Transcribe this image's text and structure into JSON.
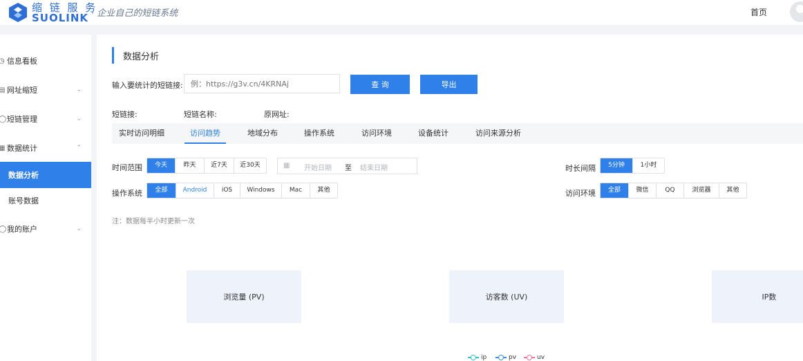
{
  "header": {
    "brand_cn": "缩 链 服 务",
    "brand_en": "SUOLINK",
    "slogan": "· 企业自己的短链系统",
    "home": "首页"
  },
  "sidebar": {
    "items": [
      {
        "label": "信息看板",
        "icon": "clock-icon"
      },
      {
        "label": "网址缩短",
        "icon": "page-icon"
      },
      {
        "label": "短链管理",
        "icon": "link-icon"
      },
      {
        "label": "数据统计",
        "icon": "stats-icon"
      },
      {
        "label": "数据分析"
      },
      {
        "label": "账号数据"
      },
      {
        "label": "我的账户",
        "icon": "user-icon"
      }
    ]
  },
  "main": {
    "title": "数据分析",
    "input_label": "输入要统计的短链接:",
    "input_placeholder": "例：https://g3v.cn/4KRNAj",
    "query_button": "查 询",
    "export_button": "导出",
    "info": {
      "short_link": "短链接:",
      "short_name": "短链名称:",
      "origin_url": "原网址:"
    },
    "tabs": [
      "实时访问明细",
      "访问趋势",
      "地域分布",
      "操作系统",
      "访问环境",
      "设备统计",
      "访问来源分析"
    ],
    "active_tab": "访问趋势",
    "time_range": {
      "label": "时间范围",
      "options": [
        "今天",
        "昨天",
        "近7天",
        "近30天"
      ],
      "selected": "今天"
    },
    "date_range": {
      "start_placeholder": "开始日期",
      "sep": "至",
      "end_placeholder": "结束日期"
    },
    "interval": {
      "label": "时长间隔",
      "options": [
        "5分钟",
        "1小时"
      ],
      "selected": "5分钟"
    },
    "os": {
      "label": "操作系统",
      "options": [
        "全部",
        "Android",
        "iOS",
        "Windows",
        "Mac",
        "其他"
      ],
      "selected": "全部"
    },
    "env": {
      "label": "访问环境",
      "options": [
        "全部",
        "微信",
        "QQ",
        "浏览器",
        "其他"
      ],
      "selected": "全部"
    },
    "note": "注：数据每半小时更新一次",
    "cards": [
      "浏览量 (PV)",
      "访客数 (UV)",
      "IP数"
    ],
    "legend": [
      {
        "name": "ip",
        "color": "#36c3c3"
      },
      {
        "name": "pv",
        "color": "#3a8ee6"
      },
      {
        "name": "uv",
        "color": "#f0759a"
      }
    ]
  }
}
